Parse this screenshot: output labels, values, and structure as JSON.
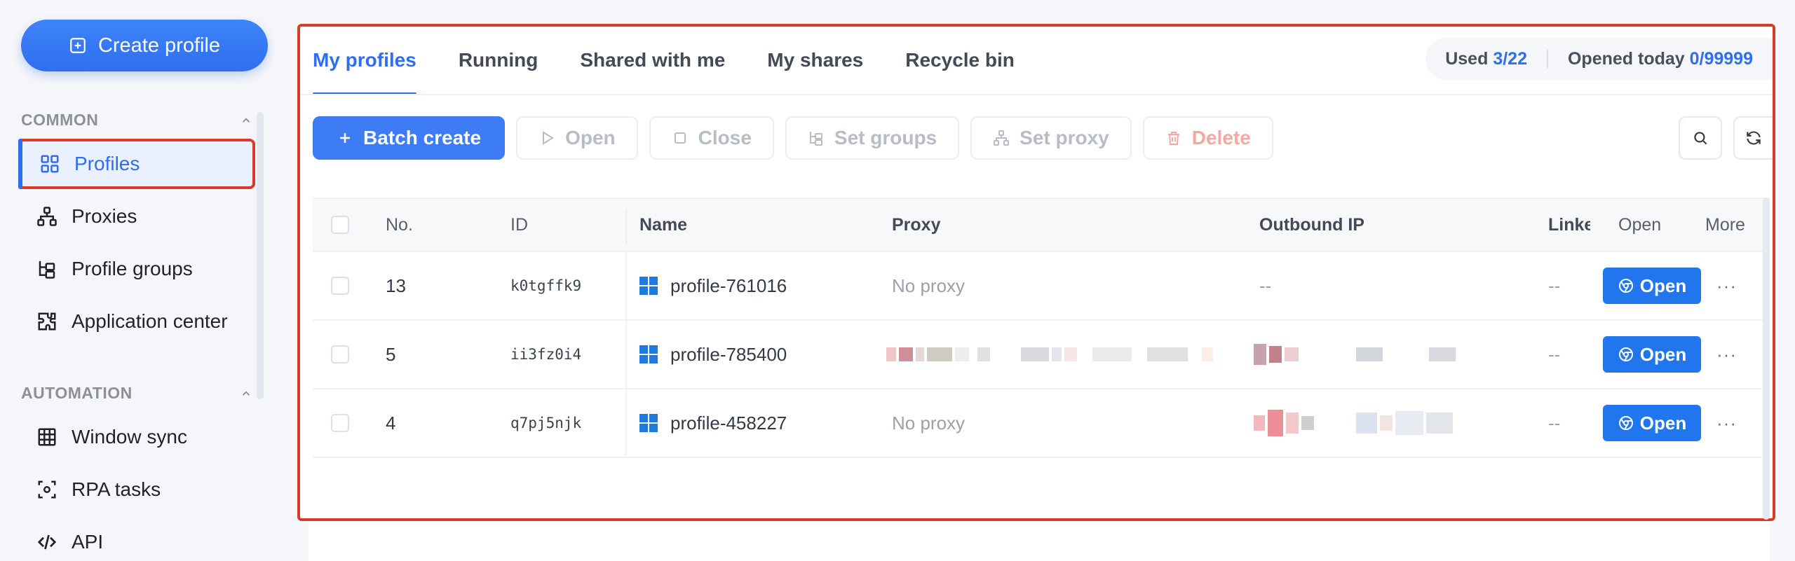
{
  "sidebar": {
    "create_label": "Create profile",
    "sections": [
      {
        "title": "COMMON",
        "items": [
          {
            "label": "Profiles",
            "icon": "grid-icon",
            "active": true
          },
          {
            "label": "Proxies",
            "icon": "network-icon"
          },
          {
            "label": "Profile groups",
            "icon": "tree-icon"
          },
          {
            "label": "Application center",
            "icon": "puzzle-icon"
          }
        ]
      },
      {
        "title": "AUTOMATION",
        "items": [
          {
            "label": "Window sync",
            "icon": "table-icon"
          },
          {
            "label": "RPA tasks",
            "icon": "scan-icon"
          },
          {
            "label": "API",
            "icon": "code-icon"
          }
        ]
      }
    ]
  },
  "tabs": [
    {
      "label": "My profiles",
      "active": true
    },
    {
      "label": "Running"
    },
    {
      "label": "Shared with me"
    },
    {
      "label": "My shares"
    },
    {
      "label": "Recycle bin"
    }
  ],
  "usage": {
    "used_label": "Used",
    "used_value": "3/22",
    "opened_label": "Opened today",
    "opened_value": "0/99999"
  },
  "toolbar": {
    "batch_create": "Batch create",
    "open": "Open",
    "close": "Close",
    "set_groups": "Set groups",
    "set_proxy": "Set proxy",
    "delete": "Delete"
  },
  "table": {
    "headers": {
      "no": "No.",
      "id": "ID",
      "name": "Name",
      "proxy": "Proxy",
      "outbound_ip": "Outbound IP",
      "linked": "Linke",
      "open": "Open",
      "more": "More"
    },
    "rows": [
      {
        "no": "13",
        "id": "k0tgffk9",
        "name": "profile-761016",
        "proxy": "No proxy",
        "outbound_ip": "--",
        "linked": "--",
        "open_label": "Open"
      },
      {
        "no": "5",
        "id": "ii3fz0i4",
        "name": "profile-785400",
        "proxy": "",
        "outbound_ip": "",
        "linked": "--",
        "open_label": "Open"
      },
      {
        "no": "4",
        "id": "q7pj5njk",
        "name": "profile-458227",
        "proxy": "No proxy",
        "outbound_ip": "",
        "linked": "--",
        "open_label": "Open"
      }
    ],
    "more_glyph": "···"
  },
  "colors": {
    "accent": "#2f6ef0",
    "highlight_border": "#d93b2b",
    "open_button": "#2176ee"
  }
}
